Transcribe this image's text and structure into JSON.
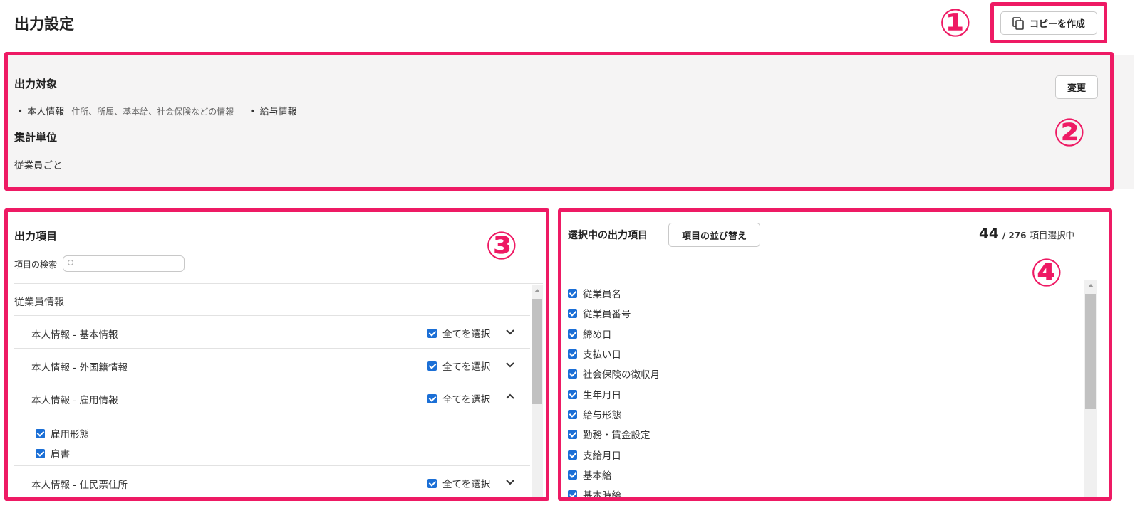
{
  "page": {
    "title": "出力設定"
  },
  "header": {
    "copy_button_label": "コピーを作成"
  },
  "target_section": {
    "title": "出力対象",
    "change_button_label": "変更",
    "items": [
      {
        "label": "本人情報",
        "description": "住所、所属、基本給、社会保険などの情報"
      },
      {
        "label": "給与情報",
        "description": ""
      }
    ],
    "aggregation_title": "集計単位",
    "aggregation_value": "従業員ごと"
  },
  "output_items": {
    "title": "出力項目",
    "search_label": "項目の検索",
    "search_placeholder": "",
    "group_name": "従業員情報",
    "select_all_label": "全てを選択",
    "categories": [
      {
        "label": "本人情報 - 基本情報",
        "expanded": false,
        "checked": true
      },
      {
        "label": "本人情報 - 外国籍情報",
        "expanded": false,
        "checked": true
      },
      {
        "label": "本人情報 - 雇用情報",
        "expanded": true,
        "checked": true,
        "children": [
          "雇用形態",
          "肩書"
        ]
      },
      {
        "label": "本人情報 - 住民票住所",
        "expanded": false,
        "checked": true
      }
    ]
  },
  "selected_items": {
    "title": "選択中の出力項目",
    "reorder_button_label": "項目の並び替え",
    "selected_count": "44",
    "total_count": "/ 276",
    "count_suffix": "項目選択中",
    "items": [
      "従業員名",
      "従業員番号",
      "締め日",
      "支払い日",
      "社会保険の徴収月",
      "生年月日",
      "給与形態",
      "勤務・賃金設定",
      "支給月日",
      "基本給",
      "基本時給"
    ]
  },
  "annotations": {
    "color": "#ee1a64",
    "labels": [
      "①",
      "②",
      "③",
      "④"
    ]
  },
  "colors": {
    "checkbox": "#1b6fd6",
    "panel_bg": "#f5f4f4"
  },
  "icons": [
    "copy-icon",
    "search-icon",
    "chevron-down-icon",
    "chevron-up-icon",
    "checkbox-checked-icon"
  ]
}
